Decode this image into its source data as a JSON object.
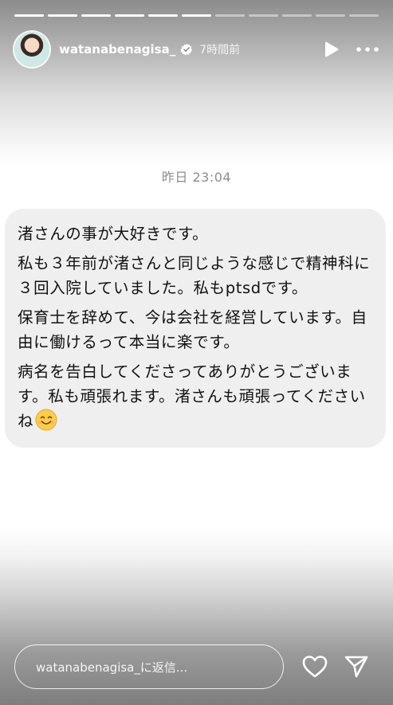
{
  "story": {
    "progress_segments_total": 11,
    "progress_segments_done": 6,
    "username": "watanabenagisa_",
    "time_ago": "7時間前",
    "verified_icon": "verified-badge-icon",
    "play_icon": "play-icon",
    "more_icon": "more-dots-icon"
  },
  "message": {
    "timestamp": "昨日 23:04",
    "paragraphs": [
      "渚さんの事が大好きです。",
      "私も３年前が渚さんと同じような感じで精神科に３回入院していました。私もptsdです。",
      "保育士を辞めて、今は会社を経営しています。自由に働けるって本当に楽です。",
      "病名を告白してくださってありがとうございます。私も頑張れます。渚さんも頑張ってくださいね"
    ],
    "emoji": "smiling-face-icon"
  },
  "reply": {
    "placeholder": "watanabenagisa_に返信...",
    "like_icon": "heart-icon",
    "send_icon": "send-icon"
  }
}
